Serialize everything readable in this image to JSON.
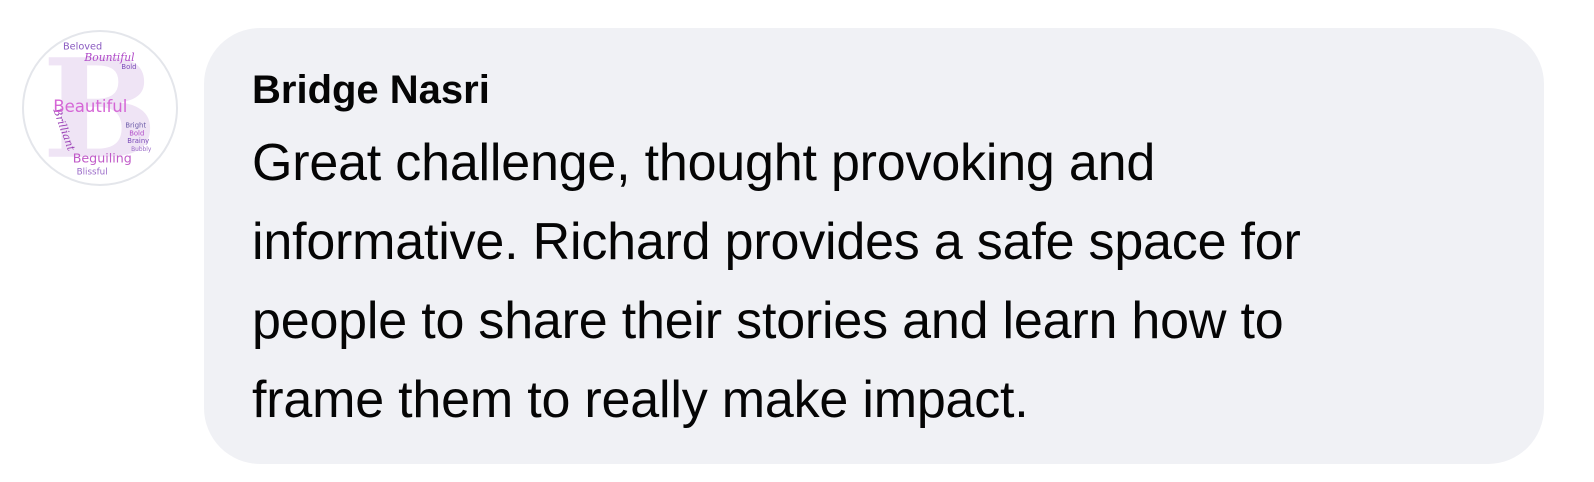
{
  "comment": {
    "author": "Bridge Nasri",
    "text": "Great challenge, thought provoking and\ninformative.  Richard provides a safe space for\npeople to share their stories and learn how to\nframe them to really make impact."
  },
  "avatar": {
    "icon": "word-cloud-letter-b-avatar",
    "letter": "B",
    "words": [
      "Beloved",
      "Bountiful",
      "Bold",
      "Brilliant",
      "Beautiful",
      "Bright",
      "Bold",
      "Brainy",
      "Bubbly",
      "Beguiling",
      "Blissful"
    ]
  },
  "colors": {
    "bubble_background": "#f0f1f5",
    "text": "#050505",
    "avatar_accent": "#b04ac8"
  }
}
